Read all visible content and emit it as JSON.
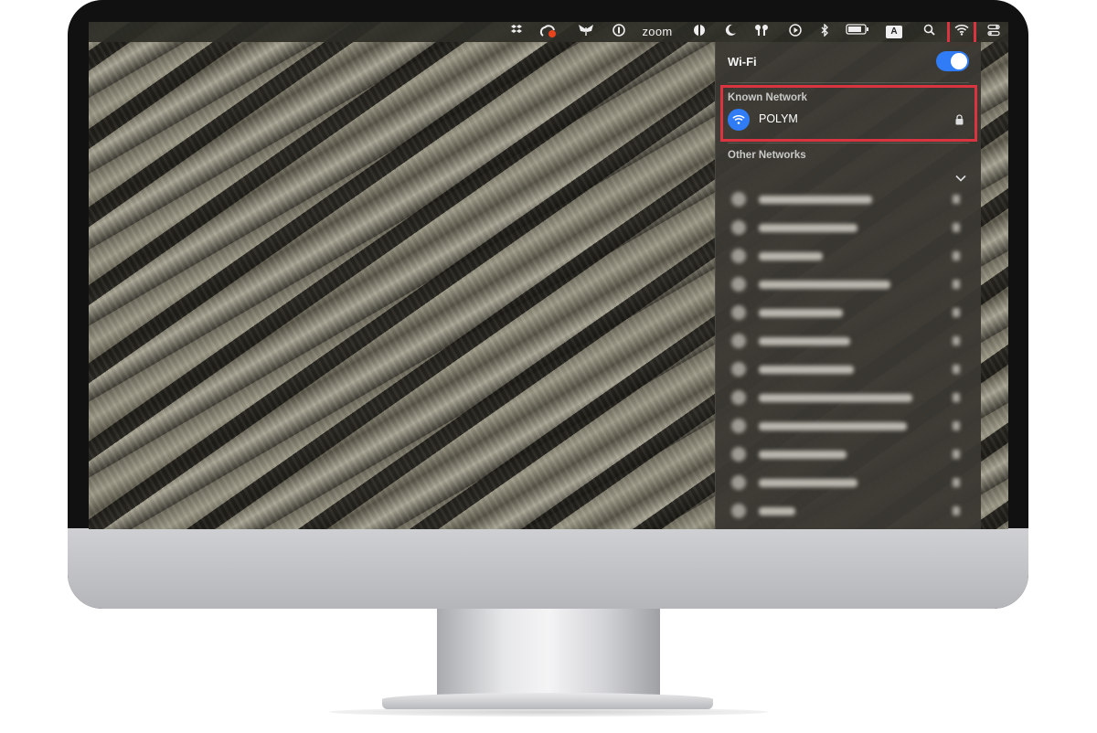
{
  "menubar": {
    "icons": [
      "dropbox-icon",
      "creative-cloud-icon",
      "butterfly-icon",
      "one-password-icon",
      "zoom-icon",
      "cloudflare-icon",
      "do-not-disturb-moon-icon",
      "airpods-icon",
      "play-icon",
      "bluetooth-icon",
      "battery-icon",
      "input-source-icon",
      "search-icon",
      "wifi-icon",
      "control-center-icon"
    ],
    "zoom_label": "zoom",
    "input_source_label": "A"
  },
  "wifi_panel": {
    "title": "Wi-Fi",
    "enabled": true,
    "known_network_label": "Known Network",
    "known_networks": [
      {
        "name": "POLYM",
        "secured": true
      }
    ],
    "other_networks_label": "Other Networks",
    "other_networks_count": 13
  },
  "colors": {
    "accent": "#2f7cf6",
    "highlight": "#d9343f"
  }
}
